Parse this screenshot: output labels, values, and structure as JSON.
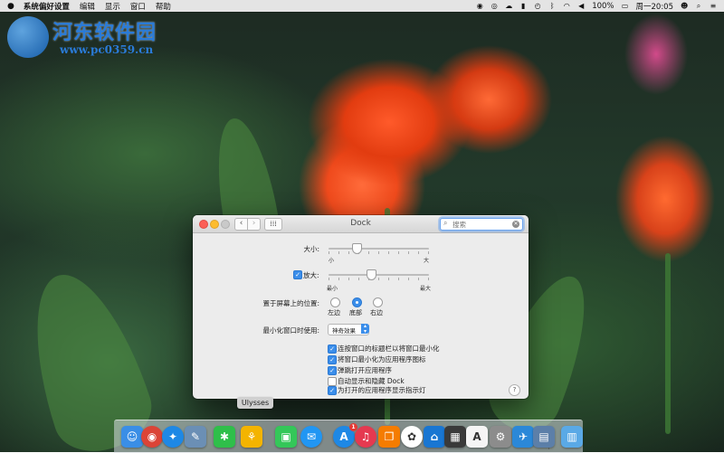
{
  "menubar": {
    "app_name": "系统偏好设置",
    "menus": [
      "编辑",
      "显示",
      "窗口",
      "帮助"
    ],
    "clock": "周一20:05",
    "battery": "100%"
  },
  "watermark": {
    "title": "河东软件园",
    "url": "www.pc0359.cn"
  },
  "window": {
    "title": "Dock",
    "search": {
      "placeholder": "搜索"
    },
    "size": {
      "label": "大小:",
      "min_label": "小",
      "max_label": "大",
      "value": 0.28
    },
    "magnification": {
      "label": "放大:",
      "checked": true,
      "min_label": "最小",
      "max_label": "最大",
      "value": 0.42
    },
    "position": {
      "label": "置于屏幕上的位置:",
      "options": [
        "左边",
        "底部",
        "右边"
      ],
      "selected": "底部"
    },
    "minimize_effect": {
      "label": "最小化窗口时使用:",
      "value": "神奇效果"
    },
    "options": [
      {
        "label": "连按窗口的标题栏以将窗口最小化",
        "checked": true
      },
      {
        "label": "将窗口最小化为应用程序图标",
        "checked": true
      },
      {
        "label": "弹跳打开应用程序",
        "checked": true
      },
      {
        "label": "自动显示和隐藏 Dock",
        "checked": false
      },
      {
        "label": "为打开的应用程序显示指示灯",
        "checked": true
      }
    ],
    "help": "?"
  },
  "tooltip": "Ulysses",
  "dock": {
    "apps": [
      {
        "name": "finder-icon",
        "glyph": "☺",
        "color": "#3a8ee6"
      },
      {
        "name": "chrome-icon",
        "glyph": "◉",
        "color": "#db4437"
      },
      {
        "name": "safari-icon",
        "glyph": "✦",
        "color": "#1e88e5"
      },
      {
        "name": "preview-icon",
        "glyph": "✎",
        "color": "#6b8fb5"
      },
      {
        "name": "mindnode-icon",
        "glyph": "✱",
        "color": "#2fbf4a"
      },
      {
        "name": "ulysses-icon",
        "glyph": "⚘",
        "color": "#f4b400"
      },
      {
        "name": "facetime-icon",
        "glyph": "▣",
        "color": "#34c759"
      },
      {
        "name": "messages-icon",
        "glyph": "✉",
        "color": "#2196f3"
      },
      {
        "name": "app-store-icon",
        "glyph": "A",
        "color": "#1e88e5",
        "badge": "1"
      },
      {
        "name": "music-icon",
        "glyph": "♫",
        "color": "#e53950"
      },
      {
        "name": "ibooks-icon",
        "glyph": "❐",
        "color": "#f57c00"
      },
      {
        "name": "photos-icon",
        "glyph": "✿",
        "color": "#ffffff"
      },
      {
        "name": "keynote-icon",
        "glyph": "⌂",
        "color": "#1976d2"
      },
      {
        "name": "photo-booth-icon",
        "glyph": "▦",
        "color": "#3a3a3a"
      },
      {
        "name": "dictionary-icon",
        "glyph": "A",
        "color": "#f5f5f5"
      },
      {
        "name": "system-preferences-icon",
        "glyph": "⚙",
        "color": "#8c8c8c"
      },
      {
        "name": "xcode-icon",
        "glyph": "✈",
        "color": "#2b88d8"
      },
      {
        "name": "image-capture-icon",
        "glyph": "▤",
        "color": "#5c7fa8"
      },
      {
        "name": "downloads-folder-icon",
        "glyph": "▥",
        "color": "#5aa9e6"
      }
    ]
  }
}
